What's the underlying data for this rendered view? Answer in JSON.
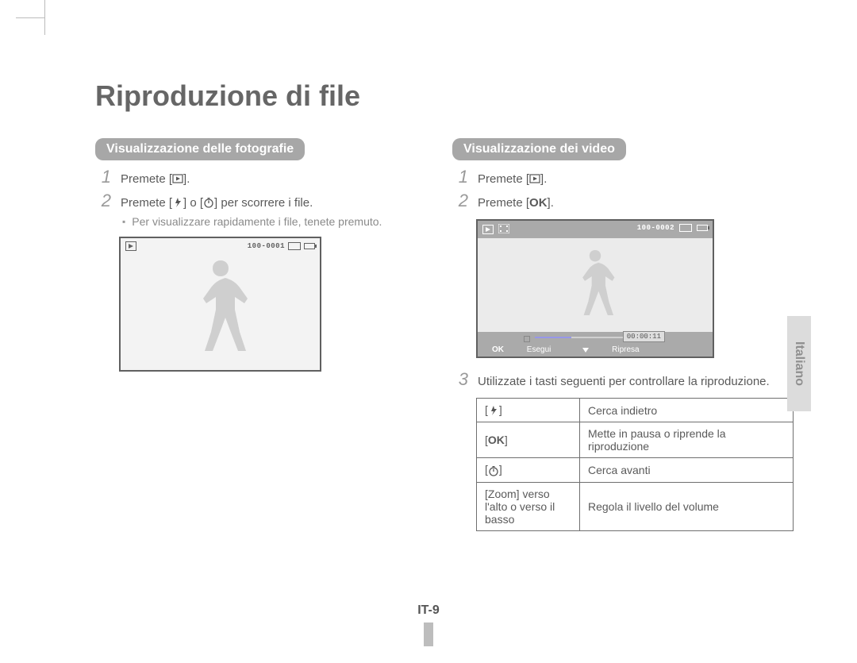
{
  "page_title": "Riproduzione di file",
  "language_label": "Italiano",
  "page_number": "IT-9",
  "left": {
    "section_title": "Visualizzazione delle fotografie",
    "steps": {
      "s1": {
        "num": "1",
        "text_prefix": "Premete [",
        "text_suffix": "]."
      },
      "s2": {
        "num": "2",
        "text_prefix": "Premete [",
        "text_mid": "] o [",
        "text_suffix": "] per scorrere i file."
      }
    },
    "sub_bullet": "Per visualizzare rapidamente i file, tenete premuto.",
    "screen": {
      "file_index": "100-0001"
    }
  },
  "right": {
    "section_title": "Visualizzazione dei video",
    "steps": {
      "s1": {
        "num": "1",
        "text_prefix": "Premete [",
        "text_suffix": "]."
      },
      "s2": {
        "num": "2",
        "text_prefix": "Premete [",
        "ok": "OK",
        "text_suffix": "]."
      },
      "s3": {
        "num": "3",
        "text": "Utilizzate i tasti seguenti per controllare la riproduzione."
      }
    },
    "screen": {
      "file_index": "100-0002",
      "time": "00:00:11",
      "fn_ok": "OK",
      "fn_label1": "Esegui",
      "fn_label2": "Ripresa"
    },
    "controls": {
      "r1_action": "Cerca indietro",
      "r2_key": "OK",
      "r2_action": "Mette in pausa o riprende la riproduzione",
      "r3_action": "Cerca avanti",
      "r4_key": "[Zoom] verso l'alto o verso il basso",
      "r4_action": "Regola il livello del volume"
    }
  }
}
